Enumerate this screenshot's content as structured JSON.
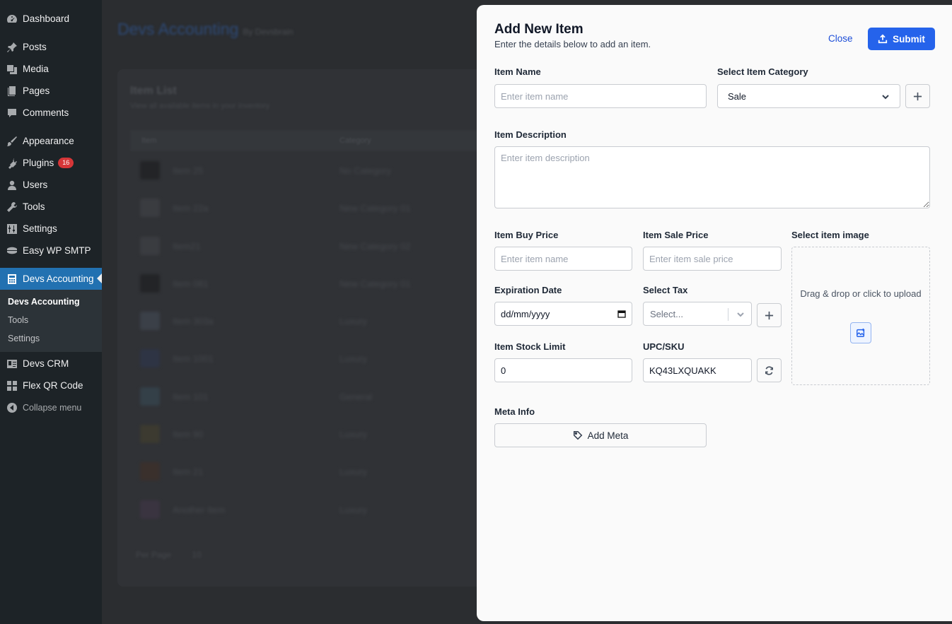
{
  "sidebar": {
    "items_top": [
      {
        "label": "Dashboard",
        "icon": "dashboard-icon"
      }
    ],
    "items_main": [
      {
        "label": "Posts",
        "icon": "pin-icon"
      },
      {
        "label": "Media",
        "icon": "media-icon"
      },
      {
        "label": "Pages",
        "icon": "pages-icon"
      },
      {
        "label": "Comments",
        "icon": "comments-icon"
      }
    ],
    "items_admin": [
      {
        "label": "Appearance",
        "icon": "brush-icon"
      },
      {
        "label": "Plugins",
        "icon": "plug-icon",
        "badge": "16"
      },
      {
        "label": "Users",
        "icon": "user-icon"
      },
      {
        "label": "Tools",
        "icon": "wrench-icon"
      },
      {
        "label": "Settings",
        "icon": "sliders-icon"
      },
      {
        "label": "Easy WP SMTP",
        "icon": "mail-icon"
      }
    ],
    "active": {
      "label": "Devs Accounting",
      "icon": "calculator-icon"
    },
    "submenu": [
      "Devs Accounting",
      "Tools",
      "Settings"
    ],
    "items_bottom": [
      {
        "label": "Devs CRM",
        "icon": "contact-icon"
      },
      {
        "label": "Flex QR Code",
        "icon": "grid-icon"
      }
    ],
    "collapse": "Collapse menu",
    "accent": "#2271b1",
    "badge_color": "#d63638"
  },
  "background_page": {
    "title": "Devs Accounting",
    "title_suffix": "By Devsbrain",
    "card_title": "Item List",
    "card_subtitle": "View all available items in your inventory",
    "columns": [
      "Item",
      "Category"
    ],
    "rows": [
      {
        "name": "Item 25",
        "category": "No Category"
      },
      {
        "name": "Item 22a",
        "category": "New Category 01"
      },
      {
        "name": "Item21",
        "category": "New Category 02"
      },
      {
        "name": "Item 081",
        "category": "New Category 01"
      },
      {
        "name": "Item 303a",
        "category": "Luxury"
      },
      {
        "name": "Item 1001",
        "category": "Luxury"
      },
      {
        "name": "Item 101",
        "category": "General"
      },
      {
        "name": "Item 90",
        "category": "Luxury"
      },
      {
        "name": "Item 21",
        "category": "Luxury"
      },
      {
        "name": "Another Item",
        "category": "Luxury"
      }
    ],
    "per_page_label": "Per Page",
    "per_page_value": "10"
  },
  "modal": {
    "title": "Add New Item",
    "subtitle": "Enter the details below to add an item.",
    "close_label": "Close",
    "submit_label": "Submit",
    "fields": {
      "item_name": {
        "label": "Item Name",
        "placeholder": "Enter item name"
      },
      "category": {
        "label": "Select Item Category",
        "value": "Sale"
      },
      "description": {
        "label": "Item Description",
        "placeholder": "Enter item description"
      },
      "buy_price": {
        "label": "Item Buy Price",
        "placeholder": "Enter item name"
      },
      "sale_price": {
        "label": "Item Sale Price",
        "placeholder": "Enter item sale price"
      },
      "image": {
        "label": "Select item image",
        "dropzone_text": "Drag & drop or click to upload"
      },
      "expiration": {
        "label": "Expiration Date",
        "value": "dd/mm/yyyy"
      },
      "tax": {
        "label": "Select Tax",
        "placeholder": "Select..."
      },
      "stock_limit": {
        "label": "Item Stock Limit",
        "value": "0"
      },
      "sku": {
        "label": "UPC/SKU",
        "value": "KQ43LXQUAKK"
      },
      "meta": {
        "label": "Meta Info",
        "button": "Add Meta"
      }
    },
    "primary_color": "#2563eb"
  }
}
